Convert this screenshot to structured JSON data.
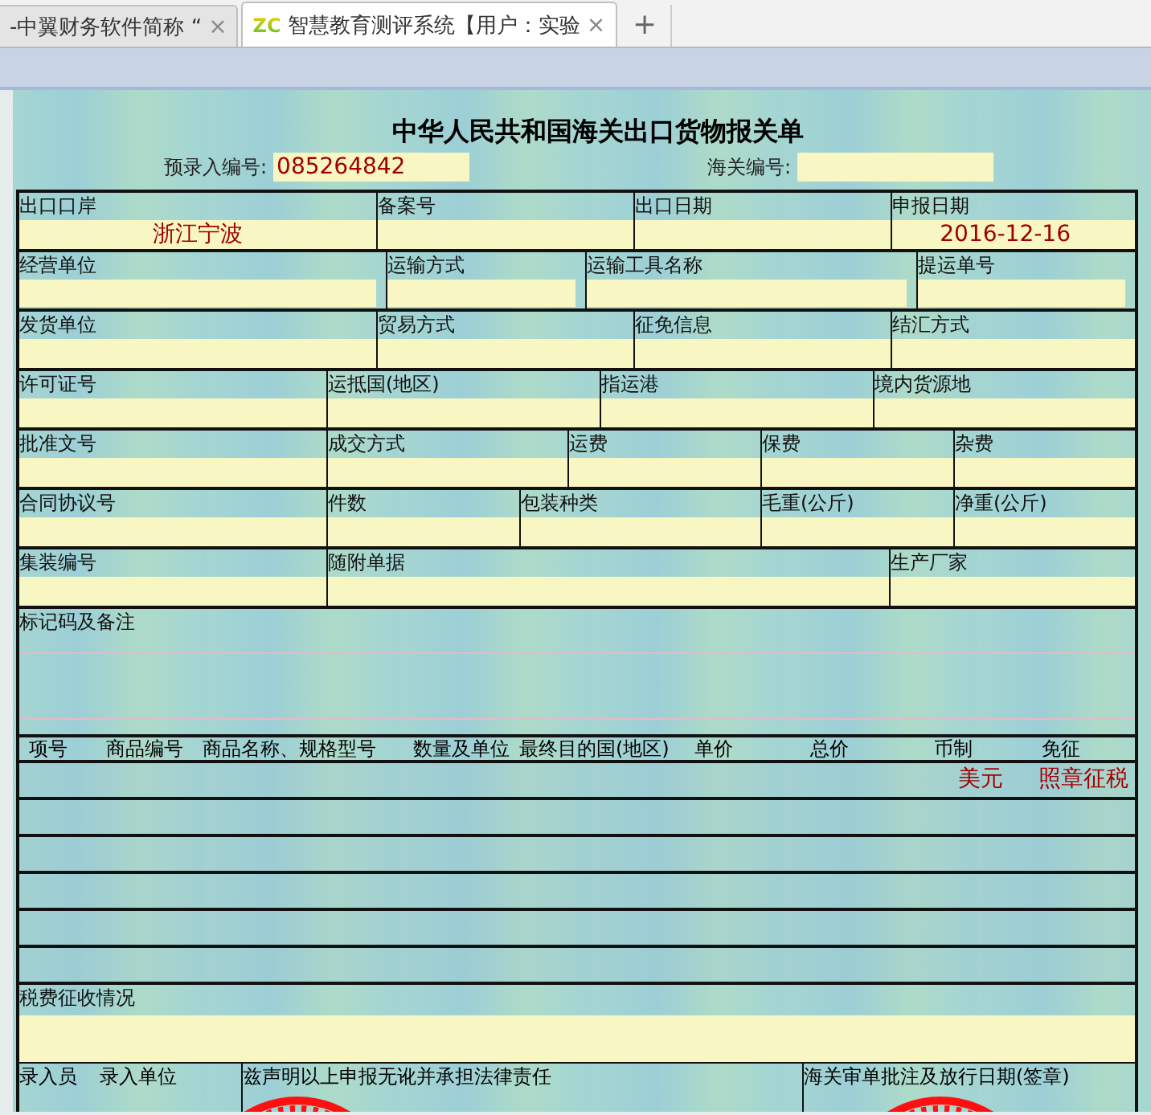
{
  "tabs": [
    {
      "label": "-中翼财务软件简称 “",
      "selected": false,
      "close": "×"
    },
    {
      "label": "智慧教育测评系统【用户：实验",
      "selected": true,
      "logo": "ZC",
      "close": "×"
    }
  ],
  "new_tab": "+",
  "form": {
    "title": "中华人民共和国海关出口货物报关单",
    "pre_entry": {
      "label": "预录入编号:",
      "value": "085264842"
    },
    "customs_no": {
      "label": "海关编号:"
    },
    "lines": [
      {
        "fields": [
          {
            "label": "出口口岸",
            "value": "浙江宁波"
          },
          {
            "label": "备案号"
          },
          {
            "label": "出口日期"
          },
          {
            "label": "申报日期",
            "value": "2016-12-16"
          }
        ]
      },
      {
        "fields": [
          {
            "label": "经营单位"
          },
          {
            "label": "运输方式"
          },
          {
            "label": "运输工具名称"
          },
          {
            "label": "提运单号"
          }
        ]
      },
      {
        "fields": [
          {
            "label": "发货单位"
          },
          {
            "label": "贸易方式"
          },
          {
            "label": "征免信息"
          },
          {
            "label": "结汇方式"
          }
        ]
      },
      {
        "fields": [
          {
            "label": "许可证号"
          },
          {
            "label": "运抵国(地区)"
          },
          {
            "label": "指运港"
          },
          {
            "label": "境内货源地"
          }
        ]
      },
      {
        "fields": [
          {
            "label": "批准文号"
          },
          {
            "label": "成交方式"
          },
          {
            "label": "运费"
          },
          {
            "label": "保费"
          },
          {
            "label": "杂费"
          }
        ]
      },
      {
        "fields": [
          {
            "label": "合同协议号"
          },
          {
            "label": "件数"
          },
          {
            "label": "包装种类"
          },
          {
            "label": "毛重(公斤)"
          },
          {
            "label": "净重(公斤)"
          }
        ]
      },
      {
        "fields": [
          {
            "label": "集装编号"
          },
          {
            "label": "随附单据"
          },
          {
            "label": "生产厂家"
          }
        ]
      }
    ],
    "remarks_label": "标记码及备注",
    "item_columns": [
      "项号",
      "商品编号",
      "商品名称、规格型号",
      "数量及单位",
      "最终目的国(地区)",
      "单价",
      "总价",
      "币制",
      "免征"
    ],
    "item_rows": [
      {
        "currency": "美元",
        "exemption": "照章征税"
      },
      {},
      {},
      {},
      {},
      {}
    ],
    "tax_label": "税费征收情况",
    "footer": {
      "clerk": "录入员",
      "entry_unit": "录入单位",
      "declaration": "兹声明以上申报无讹并承担法律责任",
      "approval": "海关审单批注及放行日期(签章)"
    }
  }
}
